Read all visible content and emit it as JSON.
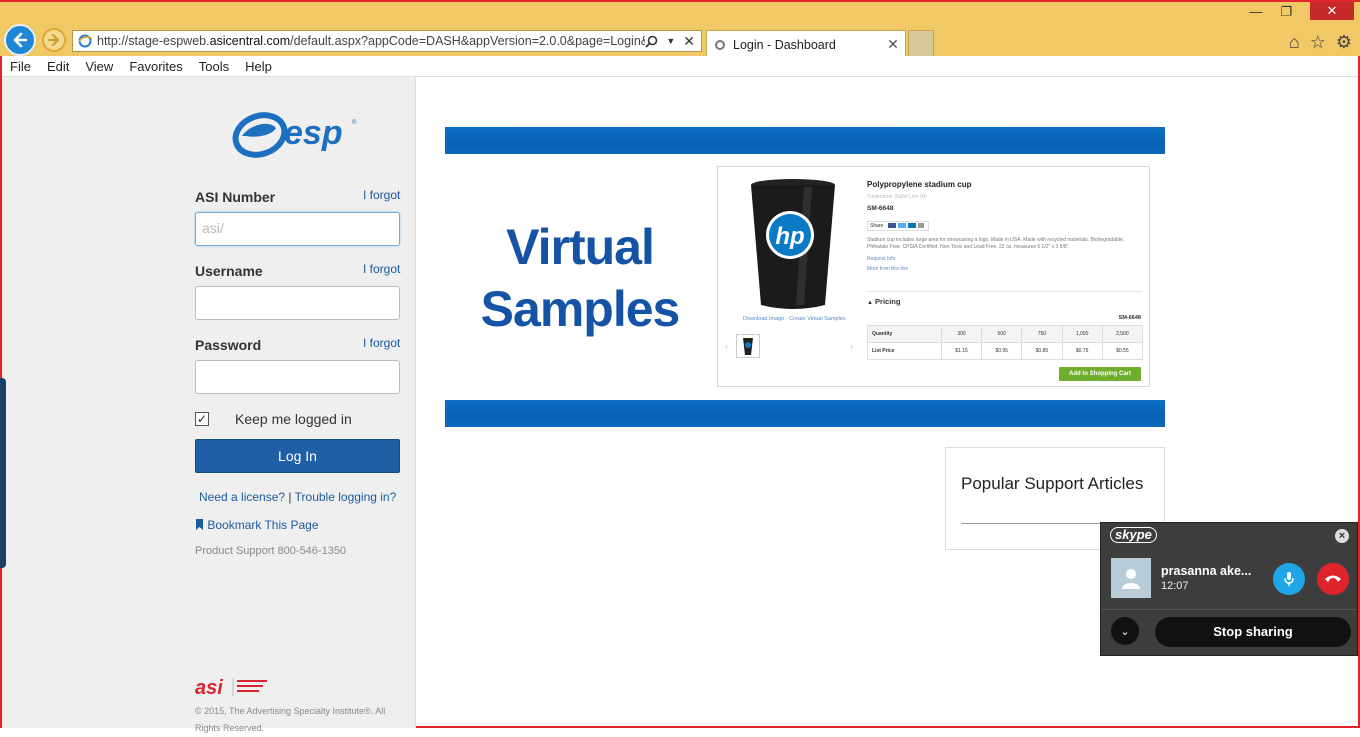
{
  "browser": {
    "url_prefix": "http://stage-espweb.",
    "url_domain": "asicentral.com",
    "url_path": "/default.aspx?appCode=DASH&appVersion=2.0.0&page=Login&Ses",
    "tab_title": "Login - Dashboard",
    "menu": [
      "File",
      "Edit",
      "View",
      "Favorites",
      "Tools",
      "Help"
    ]
  },
  "login": {
    "asi_label": "ASI Number",
    "asi_forgot": "I forgot",
    "asi_placeholder": "asi/",
    "username_label": "Username",
    "username_forgot": "I forgot",
    "password_label": "Password",
    "password_forgot": "I forgot",
    "remember_label": "Keep me logged in",
    "remember_checked": "✓",
    "login_button": "Log In",
    "need_license": "Need a license?",
    "separator": "|",
    "trouble": "Trouble logging in?",
    "bookmark": "Bookmark This Page",
    "support": "Product Support 800-546-1350",
    "copyright": "© 2015, The Advertising Specialty Institute®. All Rights Reserved."
  },
  "banner": {
    "title_line1": "Virtual",
    "title_line2": "Samples"
  },
  "product": {
    "title": "Polypropylene stadium cup",
    "subtitle": "Tradename: Bullet Line (R)",
    "sku": "SM-6648",
    "share": "Share",
    "description": "Stadium cup includes large area for showcasing a logo. Made in USA. Made with recycled materials. Biodegradable, Phthalate Free, CPSIA Certified, Non-Toxic and Lead Free. 22 oz. measures 5 1/2\" x 3 5/8\".",
    "request_info": "Request Info",
    "more_from_line": "More from this line",
    "image_links": "Download Image  ·  Create Virtual Samples",
    "pricing_label": "Pricing",
    "pricing_sku": "SM-6648",
    "quantity_label": "Quantity",
    "list_price_label": "List Price",
    "quantities": [
      "300",
      "500",
      "750",
      "1,000",
      "2,500"
    ],
    "prices": [
      "$1.15",
      "$0.95",
      "$0.85",
      "$0.75",
      "$0.55"
    ],
    "cart_button": "Add to Shopping Cart"
  },
  "popular": {
    "title": "Popular Support Articles"
  },
  "skype": {
    "logo": "skype",
    "contact_name": "prasanna ake...",
    "call_time": "12:07",
    "stop_sharing": "Stop sharing"
  },
  "colors": {
    "brand_blue": "#1f5fa6",
    "band_blue": "#0a62b4",
    "titlebar": "#f0c865",
    "skype_bg": "#3d3d3d"
  }
}
